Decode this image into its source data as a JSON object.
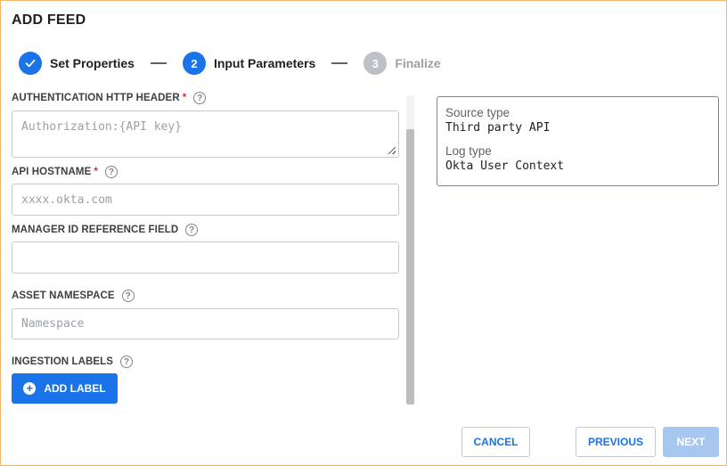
{
  "dialog": {
    "title": "ADD FEED"
  },
  "stepper": {
    "steps": [
      {
        "number": "✓",
        "label": "Set Properties",
        "state": "completed"
      },
      {
        "number": "2",
        "label": "Input Parameters",
        "state": "active"
      },
      {
        "number": "3",
        "label": "Finalize",
        "state": "inactive"
      }
    ]
  },
  "form": {
    "auth_header": {
      "label": "AUTHENTICATION HTTP HEADER",
      "required": "*",
      "placeholder": "Authorization:{API key}"
    },
    "api_hostname": {
      "label": "API HOSTNAME",
      "required": "*",
      "placeholder": "xxxx.okta.com"
    },
    "manager_id": {
      "label": "MANAGER ID REFERENCE FIELD",
      "placeholder": ""
    },
    "asset_namespace": {
      "label": "ASSET NAMESPACE",
      "placeholder": "Namespace"
    },
    "ingestion_labels": {
      "label": "INGESTION LABELS",
      "add_button": "ADD LABEL"
    },
    "help_glyph": "?"
  },
  "summary": {
    "source_type_key": "Source type",
    "source_type_value": "Third party API",
    "log_type_key": "Log type",
    "log_type_value": "Okta User Context"
  },
  "footer": {
    "cancel": "CANCEL",
    "previous": "PREVIOUS",
    "next": "NEXT"
  },
  "colors": {
    "accent": "#1a73e8",
    "required": "#d93025",
    "disabled": "#a8c7f0",
    "frame": "#f2b66b"
  }
}
